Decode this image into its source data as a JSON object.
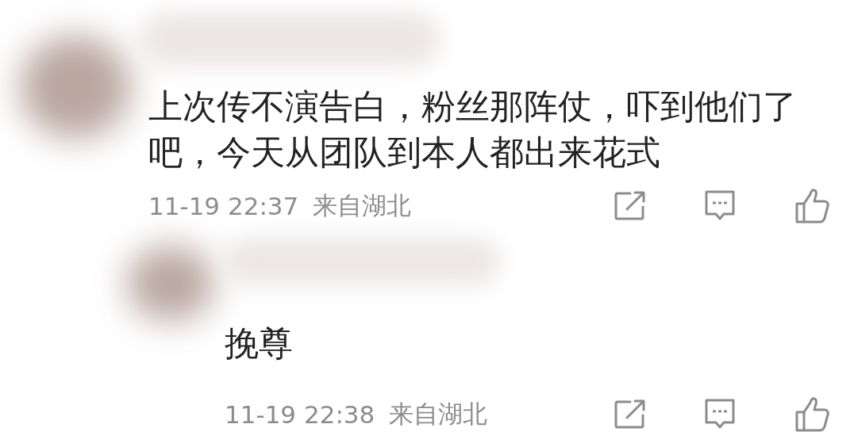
{
  "comments": [
    {
      "text": "上次传不演告白，粉丝那阵仗，吓到他们了吧，今天从团队到本人都出来花式",
      "time": "11-19 22:37",
      "location": "来自湖北",
      "reply": false
    },
    {
      "text": "挽尊",
      "time": "11-19 22:38",
      "location": "来自湖北",
      "reply": true
    }
  ]
}
